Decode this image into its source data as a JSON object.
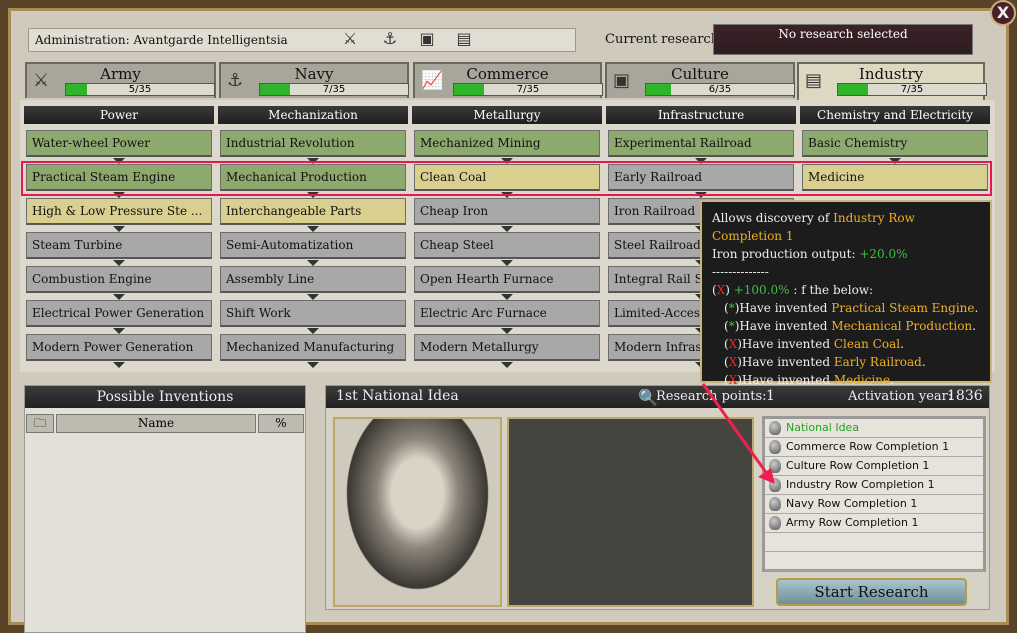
{
  "window": {
    "close": "X"
  },
  "admin": {
    "label": "Administration:  Avantgarde Intelligentsia",
    "icons": [
      "army-minus-icon",
      "navy-minus-icon",
      "culture-plus-icon",
      "industry-minus-icon"
    ]
  },
  "current_research": {
    "label": "Current research:",
    "value": "No research selected"
  },
  "tabs": [
    {
      "label": "Army",
      "progress": "5/35",
      "fraction": 0.143,
      "icon": "crossed-swords-icon"
    },
    {
      "label": "Navy",
      "progress": "7/35",
      "fraction": 0.2,
      "icon": "anchor-icon"
    },
    {
      "label": "Commerce",
      "progress": "7/35",
      "fraction": 0.2,
      "icon": "chart-icon"
    },
    {
      "label": "Culture",
      "progress": "6/35",
      "fraction": 0.171,
      "icon": "painting-icon"
    },
    {
      "label": "Industry",
      "progress": "7/35",
      "fraction": 0.2,
      "icon": "factory-icon",
      "selected": true
    }
  ],
  "columns": [
    {
      "title": "Power",
      "techs": [
        {
          "name": "Water-wheel Power",
          "state": "researched"
        },
        {
          "name": "Practical Steam Engine",
          "state": "researched"
        },
        {
          "name": "High & Low Pressure Ste ...",
          "state": "available"
        },
        {
          "name": "Steam Turbine",
          "state": "locked"
        },
        {
          "name": "Combustion Engine",
          "state": "locked"
        },
        {
          "name": "Electrical Power Generation",
          "state": "locked"
        },
        {
          "name": "Modern Power Generation",
          "state": "locked"
        }
      ]
    },
    {
      "title": "Mechanization",
      "techs": [
        {
          "name": "Industrial Revolution",
          "state": "researched"
        },
        {
          "name": "Mechanical Production",
          "state": "researched"
        },
        {
          "name": "Interchangeable Parts",
          "state": "available"
        },
        {
          "name": "Semi-Automatization",
          "state": "locked"
        },
        {
          "name": "Assembly Line",
          "state": "locked"
        },
        {
          "name": "Shift Work",
          "state": "locked"
        },
        {
          "name": "Mechanized Manufacturing",
          "state": "locked"
        }
      ]
    },
    {
      "title": "Metallurgy",
      "techs": [
        {
          "name": "Mechanized Mining",
          "state": "researched"
        },
        {
          "name": "Clean Coal",
          "state": "available"
        },
        {
          "name": "Cheap Iron",
          "state": "locked"
        },
        {
          "name": "Cheap Steel",
          "state": "locked"
        },
        {
          "name": "Open Hearth Furnace",
          "state": "locked"
        },
        {
          "name": "Electric Arc Furnace",
          "state": "locked"
        },
        {
          "name": "Modern Metallurgy",
          "state": "locked"
        }
      ]
    },
    {
      "title": "Infrastructure",
      "techs": [
        {
          "name": "Experimental Railroad",
          "state": "researched"
        },
        {
          "name": "Early Railroad",
          "state": "locked"
        },
        {
          "name": "Iron Railroad",
          "state": "locked"
        },
        {
          "name": "Steel Railroad",
          "state": "locked"
        },
        {
          "name": "Integral Rail System",
          "state": "locked"
        },
        {
          "name": "Limited-Access Roads",
          "state": "locked"
        },
        {
          "name": "Modern Infrastructure",
          "state": "locked"
        }
      ]
    },
    {
      "title": "Chemistry and Electricity",
      "techs": [
        {
          "name": "Basic Chemistry",
          "state": "researched"
        },
        {
          "name": "Medicine",
          "state": "available"
        }
      ]
    }
  ],
  "colors": {
    "researched": "#8ea96e",
    "available": "#d9d08f",
    "locked": "#a8a8a8",
    "highlight": "#e8184e",
    "tooltip_link": "#f0b020",
    "positive": "#3ac13a",
    "unmet": "#ee2222"
  },
  "tooltip": {
    "line1_prefix": "Allows discovery of ",
    "line1_link": "Industry Row Completion 1",
    "line2_prefix": "Iron production output: ",
    "line2_value": "+20.0%",
    "separator": "--------------",
    "cond_mark": "X",
    "cond_value": "+100.0%",
    "cond_suffix": " : f the below:",
    "conditions": [
      {
        "mark": "*",
        "met": true,
        "text": "Have invented ",
        "link": "Practical Steam Engine"
      },
      {
        "mark": "*",
        "met": true,
        "text": "Have invented ",
        "link": "Mechanical Production"
      },
      {
        "mark": "X",
        "met": false,
        "text": "Have invented ",
        "link": "Clean Coal"
      },
      {
        "mark": "X",
        "met": false,
        "text": "Have invented ",
        "link": "Early Railroad"
      },
      {
        "mark": "X",
        "met": false,
        "text": "Have invented ",
        "link": "Medicine"
      }
    ]
  },
  "possible_inventions": {
    "title": "Possible Inventions",
    "col_name": "Name",
    "col_pct": "%"
  },
  "national_idea": {
    "title": "1st National Idea",
    "rp_label": "Research points:",
    "rp_value": "1",
    "year_label": "Activation year:",
    "year_value": "1836",
    "inventions": [
      {
        "name": "National Idea",
        "highlight": true
      },
      {
        "name": "Commerce Row Completion 1"
      },
      {
        "name": "Culture Row Completion 1"
      },
      {
        "name": "Industry Row Completion 1"
      },
      {
        "name": "Navy Row Completion 1"
      },
      {
        "name": "Army Row Completion 1"
      }
    ],
    "start_button": "Start Research"
  }
}
